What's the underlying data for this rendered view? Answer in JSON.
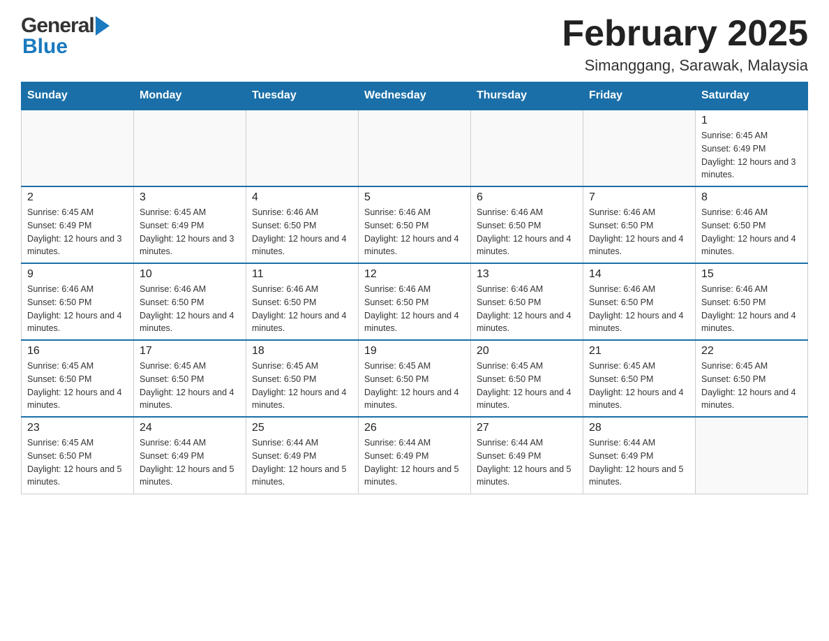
{
  "header": {
    "logo_general": "General",
    "logo_blue": "Blue",
    "month_title": "February 2025",
    "location": "Simanggang, Sarawak, Malaysia"
  },
  "days_of_week": [
    "Sunday",
    "Monday",
    "Tuesday",
    "Wednesday",
    "Thursday",
    "Friday",
    "Saturday"
  ],
  "weeks": [
    [
      {
        "day": "",
        "sunrise": "",
        "sunset": "",
        "daylight": ""
      },
      {
        "day": "",
        "sunrise": "",
        "sunset": "",
        "daylight": ""
      },
      {
        "day": "",
        "sunrise": "",
        "sunset": "",
        "daylight": ""
      },
      {
        "day": "",
        "sunrise": "",
        "sunset": "",
        "daylight": ""
      },
      {
        "day": "",
        "sunrise": "",
        "sunset": "",
        "daylight": ""
      },
      {
        "day": "",
        "sunrise": "",
        "sunset": "",
        "daylight": ""
      },
      {
        "day": "1",
        "sunrise": "Sunrise: 6:45 AM",
        "sunset": "Sunset: 6:49 PM",
        "daylight": "Daylight: 12 hours and 3 minutes."
      }
    ],
    [
      {
        "day": "2",
        "sunrise": "Sunrise: 6:45 AM",
        "sunset": "Sunset: 6:49 PM",
        "daylight": "Daylight: 12 hours and 3 minutes."
      },
      {
        "day": "3",
        "sunrise": "Sunrise: 6:45 AM",
        "sunset": "Sunset: 6:49 PM",
        "daylight": "Daylight: 12 hours and 3 minutes."
      },
      {
        "day": "4",
        "sunrise": "Sunrise: 6:46 AM",
        "sunset": "Sunset: 6:50 PM",
        "daylight": "Daylight: 12 hours and 4 minutes."
      },
      {
        "day": "5",
        "sunrise": "Sunrise: 6:46 AM",
        "sunset": "Sunset: 6:50 PM",
        "daylight": "Daylight: 12 hours and 4 minutes."
      },
      {
        "day": "6",
        "sunrise": "Sunrise: 6:46 AM",
        "sunset": "Sunset: 6:50 PM",
        "daylight": "Daylight: 12 hours and 4 minutes."
      },
      {
        "day": "7",
        "sunrise": "Sunrise: 6:46 AM",
        "sunset": "Sunset: 6:50 PM",
        "daylight": "Daylight: 12 hours and 4 minutes."
      },
      {
        "day": "8",
        "sunrise": "Sunrise: 6:46 AM",
        "sunset": "Sunset: 6:50 PM",
        "daylight": "Daylight: 12 hours and 4 minutes."
      }
    ],
    [
      {
        "day": "9",
        "sunrise": "Sunrise: 6:46 AM",
        "sunset": "Sunset: 6:50 PM",
        "daylight": "Daylight: 12 hours and 4 minutes."
      },
      {
        "day": "10",
        "sunrise": "Sunrise: 6:46 AM",
        "sunset": "Sunset: 6:50 PM",
        "daylight": "Daylight: 12 hours and 4 minutes."
      },
      {
        "day": "11",
        "sunrise": "Sunrise: 6:46 AM",
        "sunset": "Sunset: 6:50 PM",
        "daylight": "Daylight: 12 hours and 4 minutes."
      },
      {
        "day": "12",
        "sunrise": "Sunrise: 6:46 AM",
        "sunset": "Sunset: 6:50 PM",
        "daylight": "Daylight: 12 hours and 4 minutes."
      },
      {
        "day": "13",
        "sunrise": "Sunrise: 6:46 AM",
        "sunset": "Sunset: 6:50 PM",
        "daylight": "Daylight: 12 hours and 4 minutes."
      },
      {
        "day": "14",
        "sunrise": "Sunrise: 6:46 AM",
        "sunset": "Sunset: 6:50 PM",
        "daylight": "Daylight: 12 hours and 4 minutes."
      },
      {
        "day": "15",
        "sunrise": "Sunrise: 6:46 AM",
        "sunset": "Sunset: 6:50 PM",
        "daylight": "Daylight: 12 hours and 4 minutes."
      }
    ],
    [
      {
        "day": "16",
        "sunrise": "Sunrise: 6:45 AM",
        "sunset": "Sunset: 6:50 PM",
        "daylight": "Daylight: 12 hours and 4 minutes."
      },
      {
        "day": "17",
        "sunrise": "Sunrise: 6:45 AM",
        "sunset": "Sunset: 6:50 PM",
        "daylight": "Daylight: 12 hours and 4 minutes."
      },
      {
        "day": "18",
        "sunrise": "Sunrise: 6:45 AM",
        "sunset": "Sunset: 6:50 PM",
        "daylight": "Daylight: 12 hours and 4 minutes."
      },
      {
        "day": "19",
        "sunrise": "Sunrise: 6:45 AM",
        "sunset": "Sunset: 6:50 PM",
        "daylight": "Daylight: 12 hours and 4 minutes."
      },
      {
        "day": "20",
        "sunrise": "Sunrise: 6:45 AM",
        "sunset": "Sunset: 6:50 PM",
        "daylight": "Daylight: 12 hours and 4 minutes."
      },
      {
        "day": "21",
        "sunrise": "Sunrise: 6:45 AM",
        "sunset": "Sunset: 6:50 PM",
        "daylight": "Daylight: 12 hours and 4 minutes."
      },
      {
        "day": "22",
        "sunrise": "Sunrise: 6:45 AM",
        "sunset": "Sunset: 6:50 PM",
        "daylight": "Daylight: 12 hours and 4 minutes."
      }
    ],
    [
      {
        "day": "23",
        "sunrise": "Sunrise: 6:45 AM",
        "sunset": "Sunset: 6:50 PM",
        "daylight": "Daylight: 12 hours and 5 minutes."
      },
      {
        "day": "24",
        "sunrise": "Sunrise: 6:44 AM",
        "sunset": "Sunset: 6:49 PM",
        "daylight": "Daylight: 12 hours and 5 minutes."
      },
      {
        "day": "25",
        "sunrise": "Sunrise: 6:44 AM",
        "sunset": "Sunset: 6:49 PM",
        "daylight": "Daylight: 12 hours and 5 minutes."
      },
      {
        "day": "26",
        "sunrise": "Sunrise: 6:44 AM",
        "sunset": "Sunset: 6:49 PM",
        "daylight": "Daylight: 12 hours and 5 minutes."
      },
      {
        "day": "27",
        "sunrise": "Sunrise: 6:44 AM",
        "sunset": "Sunset: 6:49 PM",
        "daylight": "Daylight: 12 hours and 5 minutes."
      },
      {
        "day": "28",
        "sunrise": "Sunrise: 6:44 AM",
        "sunset": "Sunset: 6:49 PM",
        "daylight": "Daylight: 12 hours and 5 minutes."
      },
      {
        "day": "",
        "sunrise": "",
        "sunset": "",
        "daylight": ""
      }
    ]
  ]
}
